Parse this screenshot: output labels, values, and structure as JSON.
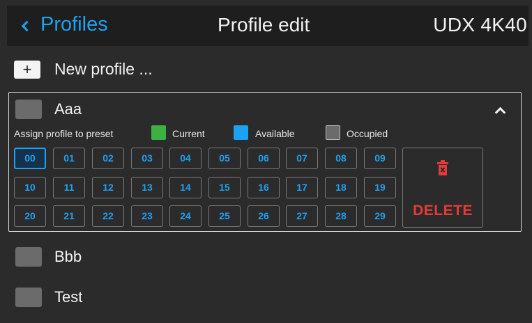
{
  "header": {
    "back_label": "Profiles",
    "title": "Profile edit",
    "device": "UDX 4K40"
  },
  "new_profile": {
    "plus_symbol": "+",
    "label": "New profile ..."
  },
  "expanded_profile": {
    "name": "Aaa",
    "assign_label": "Assign profile to preset",
    "legend": [
      {
        "label": "Current",
        "color": "#3cb043"
      },
      {
        "label": "Available",
        "color": "#1da1f2"
      },
      {
        "label": "Occupied",
        "color": "#6b6b6b"
      }
    ],
    "presets": [
      "00",
      "01",
      "02",
      "03",
      "04",
      "05",
      "06",
      "07",
      "08",
      "09",
      "10",
      "11",
      "12",
      "13",
      "14",
      "15",
      "16",
      "17",
      "18",
      "19",
      "20",
      "21",
      "22",
      "23",
      "24",
      "25",
      "26",
      "27",
      "28",
      "29"
    ],
    "selected_preset": "00",
    "delete_label": "DELETE"
  },
  "profiles": [
    {
      "name": "Bbb"
    },
    {
      "name": "Test"
    }
  ],
  "colors": {
    "accent": "#1da1f2",
    "danger": "#e53a3a",
    "background": "#2b2b2b",
    "header": "#1e1e1e"
  },
  "icons": {
    "back": "chevron-left-icon",
    "collapse": "chevron-up-icon",
    "delete": "trash-icon",
    "add": "plus-icon"
  }
}
